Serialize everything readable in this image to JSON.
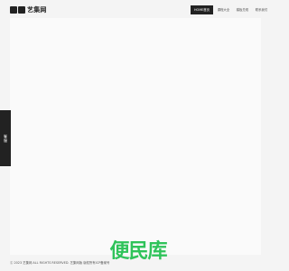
{
  "header": {
    "site_name": "艺集网",
    "logo_icon": "grid-logo-icon"
  },
  "nav": {
    "items": [
      {
        "label": "HOME首页",
        "active": true
      },
      {
        "label": "课程大全",
        "active": false
      },
      {
        "label": "模板兑现",
        "active": false
      },
      {
        "label": "联系我们",
        "active": false
      }
    ]
  },
  "side_tab": {
    "label": "客服"
  },
  "footer": {
    "copyright": "Ⓒ 2023 艺集网 ALL RIGHTS RESERVED. 艺集网版 版权所有ICP备案号"
  },
  "watermark": {
    "text": "便民库",
    "color": "#2fc35a"
  }
}
